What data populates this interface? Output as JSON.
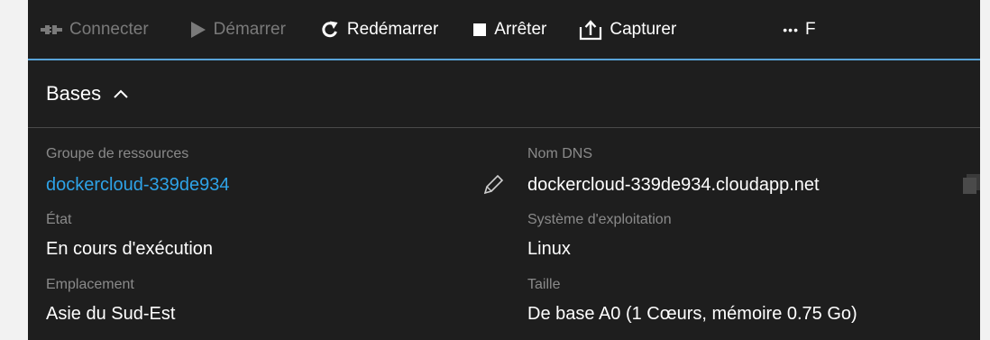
{
  "toolbar": {
    "connect": {
      "label": "Connecter",
      "icon": "connect-plug-icon",
      "enabled": false
    },
    "start": {
      "label": "Démarrer",
      "icon": "play-icon",
      "enabled": false
    },
    "restart": {
      "label": "Redémarrer",
      "icon": "restart-icon",
      "enabled": true
    },
    "stop": {
      "label": "Arrêter",
      "icon": "stop-square-icon",
      "enabled": true
    },
    "capture": {
      "label": "Capturer",
      "icon": "capture-upload-icon",
      "enabled": true
    },
    "more": {
      "label": "•••",
      "truncated_text": "F",
      "icon": "more-icon"
    }
  },
  "section": {
    "title": "Bases",
    "icon": "chevron-up-icon"
  },
  "essentials": {
    "left": [
      {
        "label": "Groupe de ressources",
        "value": "dockercloud-339de934",
        "is_link": true
      },
      {
        "label": "État",
        "value": "En cours d'exécution"
      },
      {
        "label": "Emplacement",
        "value": "Asie du Sud-Est"
      }
    ],
    "right": [
      {
        "label": "Nom DNS",
        "value": "dockercloud-339de934.cloudapp.net",
        "edit_icon": "pencil-icon",
        "copy_icon": "copy-icon"
      },
      {
        "label": "Système d'exploitation",
        "value": "Linux"
      },
      {
        "label": "Taille",
        "value": "De base A0 (1 Cœurs, mémoire 0.75 Go)"
      }
    ]
  },
  "colors": {
    "background": "#1e1e1e",
    "toolbar_border": "#59a3d8",
    "link": "#2ea3e8",
    "label": "#8a8a8a",
    "disabled": "#7a7a7a",
    "text": "#ffffff"
  }
}
